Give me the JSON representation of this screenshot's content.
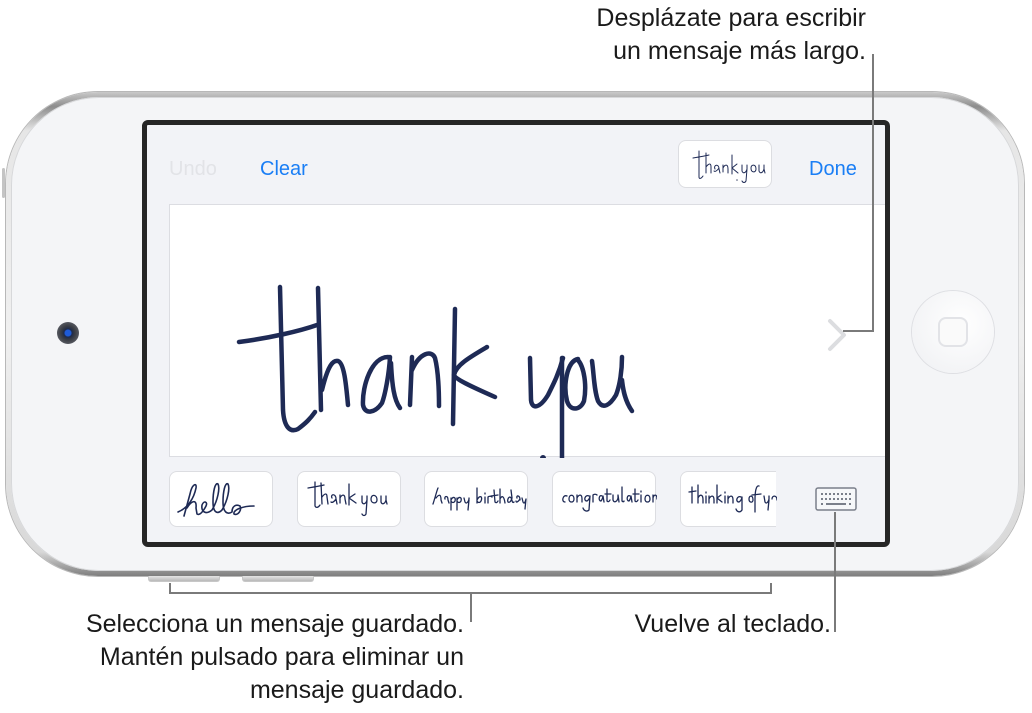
{
  "callouts": {
    "scroll": {
      "line1": "Desplázate para escribir",
      "line2": "un mensaje más largo."
    },
    "saved": {
      "line1": "Selecciona un mensaje guardado.",
      "line2": "Mantén pulsado para eliminar un",
      "line3": "mensaje guardado."
    },
    "keyboard": {
      "line1": "Vuelve al teclado."
    }
  },
  "toolbar": {
    "undo_label": "Undo",
    "clear_label": "Clear",
    "done_label": "Done",
    "preview_text": "thank you"
  },
  "canvas": {
    "handwritten_text": "thank you",
    "scroll_icon": "chevron-right-icon"
  },
  "saved_messages": [
    {
      "text": "hello"
    },
    {
      "text": "thank you"
    },
    {
      "text": "happy birthday"
    },
    {
      "text": "congratulations"
    },
    {
      "text": "thinking of you"
    }
  ],
  "keyboard_button": {
    "icon": "keyboard-icon"
  },
  "colors": {
    "accent": "#1a7ef5",
    "ink": "#1e2a55",
    "disabled": "#e2e3e7",
    "screen_bg": "#f2f3f7"
  }
}
